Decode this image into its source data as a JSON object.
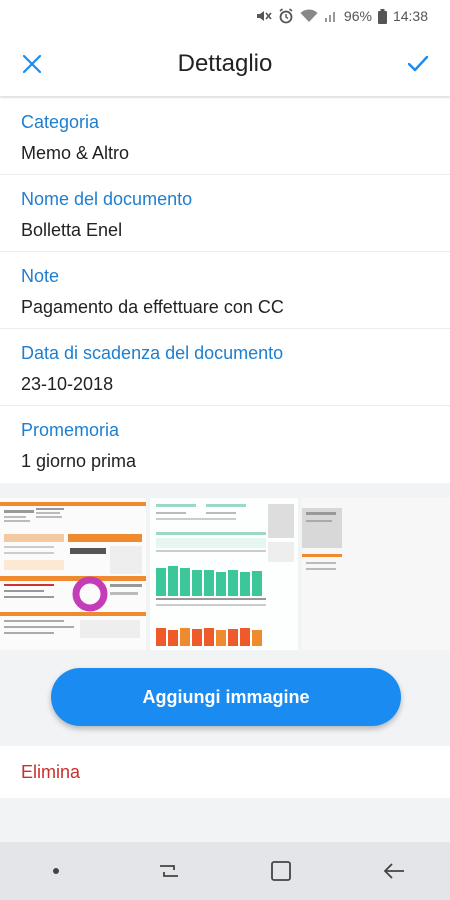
{
  "status_bar": {
    "battery": "96%",
    "time": "14:38"
  },
  "header": {
    "title": "Dettaglio"
  },
  "fields": [
    {
      "label": "Categoria",
      "value": "Memo & Altro"
    },
    {
      "label": "Nome del documento",
      "value": "Bolletta Enel"
    },
    {
      "label": "Note",
      "value": "Pagamento da effettuare con CC"
    },
    {
      "label": "Data di scadenza del documento",
      "value": "23-10-2018"
    },
    {
      "label": "Promemoria",
      "value": "1 giorno prima"
    }
  ],
  "actions": {
    "add_image": "Aggiungi immagine",
    "delete": "Elimina"
  },
  "colors": {
    "accent": "#1e7fd0",
    "button": "#1a8bf0",
    "danger": "#c9302c"
  }
}
